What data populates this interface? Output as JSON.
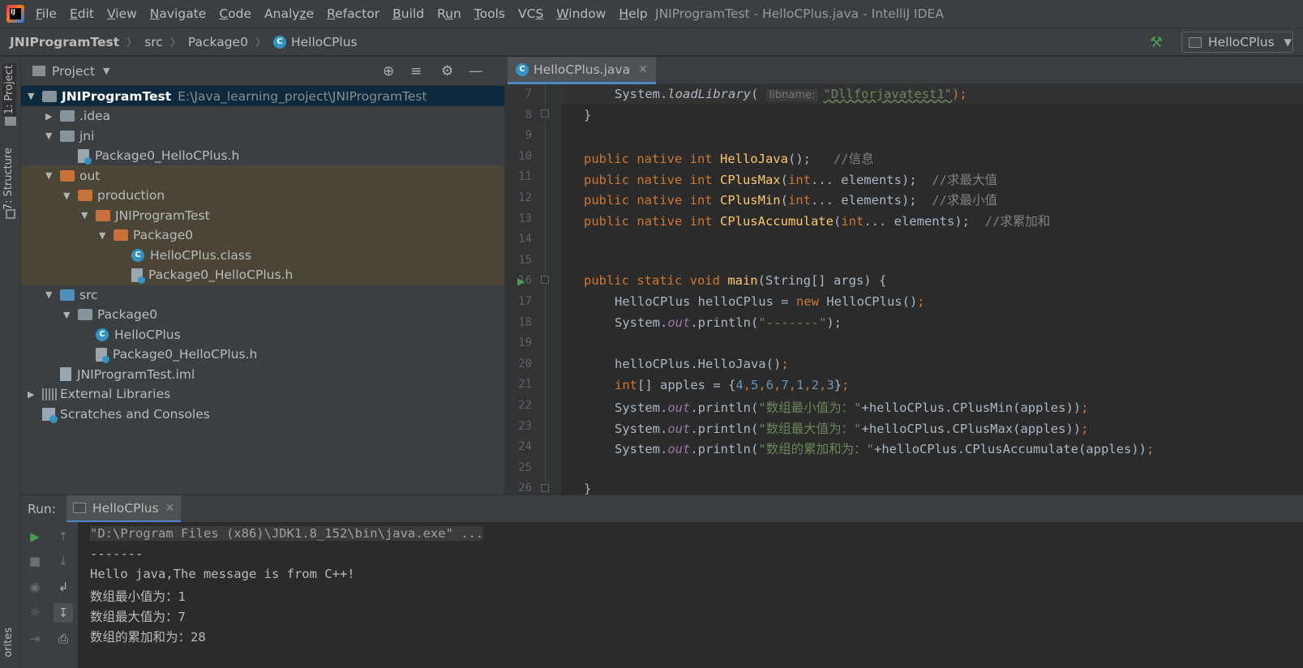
{
  "menubar": {
    "items": [
      {
        "u": "F",
        "rest": "ile"
      },
      {
        "u": "E",
        "rest": "dit"
      },
      {
        "u": "V",
        "rest": "iew"
      },
      {
        "u": "N",
        "rest": "avigate"
      },
      {
        "u": "C",
        "rest": "ode"
      },
      {
        "pre": "Analy",
        "u": "z",
        "rest": "e"
      },
      {
        "u": "R",
        "rest": "efactor"
      },
      {
        "u": "B",
        "rest": "uild"
      },
      {
        "pre": "R",
        "u": "u",
        "rest": "n"
      },
      {
        "u": "T",
        "rest": "ools"
      },
      {
        "pre": "VC",
        "u": "S",
        "rest": ""
      },
      {
        "u": "W",
        "rest": "indow"
      },
      {
        "u": "H",
        "rest": "elp"
      }
    ],
    "window_title": "JNIProgramTest - HelloCPlus.java - IntelliJ IDEA"
  },
  "navbar": {
    "crumbs": [
      "JNIProgramTest",
      "src",
      "Package0",
      "HelloCPlus"
    ],
    "run_config": "HelloCPlus"
  },
  "left_strip": {
    "project_tab": "1: Project",
    "structure_tab": "7: Structure",
    "favorites_tab": "orites"
  },
  "project_panel": {
    "title": "Project",
    "tree": [
      {
        "label": "JNIProgramTest",
        "path": "E:\\Java_learning_project\\JNIProgramTest",
        "bold": true
      },
      {
        "label": ".idea"
      },
      {
        "label": "jni"
      },
      {
        "label": "Package0_HelloCPlus.h"
      },
      {
        "label": "out"
      },
      {
        "label": "production"
      },
      {
        "label": "JNIProgramTest"
      },
      {
        "label": "Package0"
      },
      {
        "label": "HelloCPlus.class"
      },
      {
        "label": "Package0_HelloCPlus.h"
      },
      {
        "label": "src"
      },
      {
        "label": "Package0"
      },
      {
        "label": "HelloCPlus"
      },
      {
        "label": "Package0_HelloCPlus.h"
      },
      {
        "label": "JNIProgramTest.iml"
      },
      {
        "label": "External Libraries"
      },
      {
        "label": "Scratches and Consoles"
      }
    ]
  },
  "editor": {
    "tab": "HelloCPlus.java",
    "line_numbers": [
      "7",
      "8",
      "9",
      "10",
      "11",
      "12",
      "13",
      "14",
      "15",
      "16",
      "17",
      "18",
      "19",
      "20",
      "21",
      "22",
      "23",
      "24",
      "25",
      "26"
    ],
    "param_hint": "libname:",
    "code": {
      "l7a": "System.",
      "l7b": "loadLibrary",
      "l7c": "(",
      "l7d": "\"Dllforjavatest1\"",
      "l7e": ");",
      "l8": "}",
      "l10a": "public native int ",
      "l10b": "HelloJava",
      "l10c": "();",
      "l10d": "   //信息",
      "l11a": "public native int ",
      "l11b": "CPlusMax",
      "l11c": "(",
      "l11d": "int",
      "l11e": "... elements);",
      "l11f": "  //求最大值",
      "l12a": "public native int ",
      "l12b": "CPlusMin",
      "l12c": "(",
      "l12d": "int",
      "l12e": "... elements);",
      "l12f": "  //求最小值",
      "l13a": "public native int ",
      "l13b": "CPlusAccumulate",
      "l13c": "(",
      "l13d": "int",
      "l13e": "... elements);",
      "l13f": "  //求累加和",
      "l16a": "public static void ",
      "l16b": "main",
      "l16c": "(String[] args) {",
      "l17a": "HelloCPlus helloCPlus = ",
      "l17b": "new ",
      "l17c": "HelloCPlus()",
      "l17d": ";",
      "l18a": "System.",
      "l18b": "out",
      "l18c": ".println(",
      "l18d": "\"-------\"",
      "l18e": ");",
      "l20a": "helloCPlus.HelloJava()",
      "l20b": ";",
      "l21a": "int",
      "l21b": "[] apples = {",
      "l21n": [
        "4",
        "5",
        "6",
        "7",
        "1",
        "2",
        "3"
      ],
      "l21c": "}",
      "l21d": ";",
      "l22a": "System.",
      "l22b": "out",
      "l22c": ".println(",
      "l22d": "\"数组最小值为：\"",
      "l22e": "+helloCPlus.CPlusMin(apples))",
      "l22f": ";",
      "l23a": "System.",
      "l23b": "out",
      "l23c": ".println(",
      "l23d": "\"数组最大值为：\"",
      "l23e": "+helloCPlus.CPlusMax(apples))",
      "l23f": ";",
      "l24a": "System.",
      "l24b": "out",
      "l24c": ".println(",
      "l24d": "\"数组的累加和为：\"",
      "l24e": "+helloCPlus.CPlusAccumulate(apples))",
      "l24f": ";",
      "l26": "}"
    }
  },
  "run_panel": {
    "label": "Run:",
    "tab": "HelloCPlus",
    "console": [
      "\"D:\\Program Files (x86)\\JDK1.8_152\\bin\\java.exe\" ...",
      "-------",
      "Hello java,The message is from C++!",
      "数组最小值为：1",
      "数组最大值为：7",
      "数组的累加和为：28"
    ]
  },
  "colors": {
    "keyword": "#cc7832",
    "function": "#ffc66d",
    "string": "#6a8759",
    "comment": "#808080",
    "number": "#6897bb",
    "accent": "#4a88c7"
  }
}
